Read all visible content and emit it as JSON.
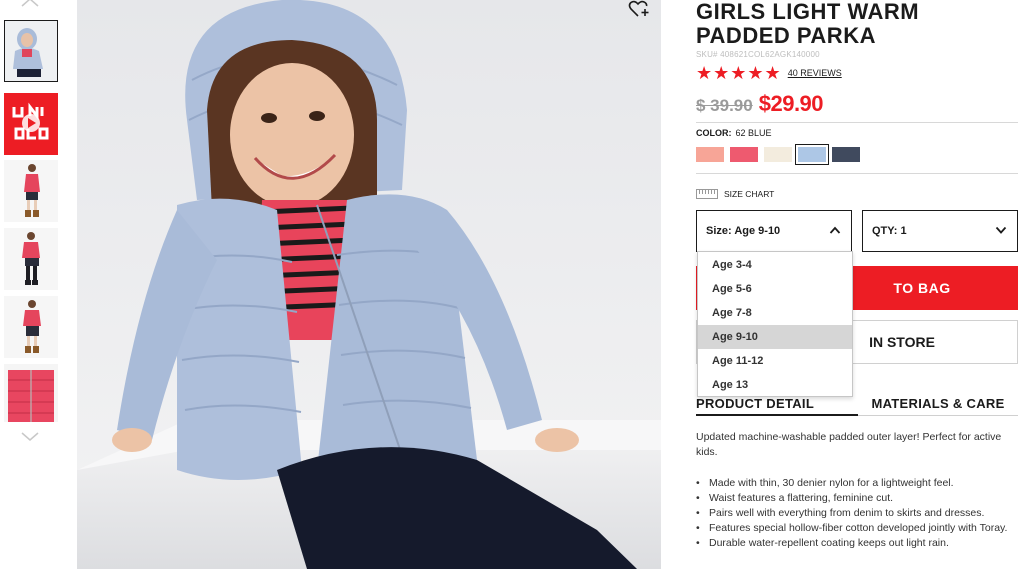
{
  "gallery": {
    "thumb_logo_text": "UNIQLO",
    "thumbnails": [
      "main-photo",
      "uniqlo-video",
      "model-front",
      "model-side",
      "model-back",
      "jacket-closeup"
    ]
  },
  "product": {
    "title": "GIRLS LIGHT WARM PADDED PARKA",
    "sku": "SKU# 408621COL62AGK140000",
    "stars": "★★★★★",
    "rating": 5,
    "reviews_label": "40 REVIEWS",
    "old_price": "$ 39.90",
    "new_price": "$29.90",
    "color_label": "COLOR:",
    "color_value": "62 BLUE",
    "swatches": [
      {
        "name": "salmon",
        "hex": "#f7a597"
      },
      {
        "name": "pink",
        "hex": "#ee5a6f"
      },
      {
        "name": "cream",
        "hex": "#f3ecde"
      },
      {
        "name": "blue",
        "hex": "#adc7e6",
        "selected": true
      },
      {
        "name": "navy",
        "hex": "#404a5e"
      }
    ],
    "size_chart_label": "SIZE CHART",
    "size_select": "Size: Age 9-10",
    "qty_select": "QTY: 1",
    "size_options": [
      "Age 3-4",
      "Age 5-6",
      "Age 7-8",
      "Age 9-10",
      "Age 11-12",
      "Age 13"
    ],
    "size_selected": "Age 9-10",
    "add_to_bag": "ADD TO BAG",
    "add_to_bag_visible": "TO BAG",
    "find_in_store": "FIND IN STORE",
    "find_in_store_visible": "IN STORE",
    "tabs": [
      "PRODUCT DETAIL",
      "MATERIALS & CARE"
    ],
    "description": "Updated machine-washable padded outer layer! Perfect for active kids.",
    "bullets": [
      "Made with thin, 30 denier nylon for a lightweight feel.",
      "Waist features a flattering, feminine cut.",
      "Pairs well with everything from denim to skirts and dresses.",
      "Features special hollow-fiber cotton developed jointly with Toray.",
      "Durable water-repellent coating keeps out light rain."
    ]
  },
  "colors": {
    "accent": "#ed1d24",
    "text": "#1b1b1b",
    "jacket": "#aebfdb"
  }
}
